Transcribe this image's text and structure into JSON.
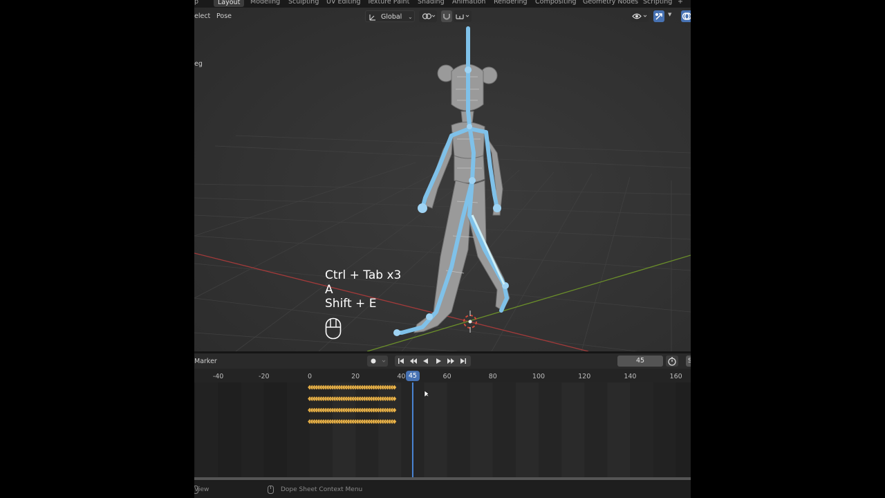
{
  "workspace_tabs": [
    {
      "label": "p",
      "active": false
    },
    {
      "label": "Layout",
      "active": true
    },
    {
      "label": "Modeling",
      "active": false
    },
    {
      "label": "Sculpting",
      "active": false
    },
    {
      "label": "UV Editing",
      "active": false
    },
    {
      "label": "Texture Paint",
      "active": false
    },
    {
      "label": "Shading",
      "active": false
    },
    {
      "label": "Animation",
      "active": false
    },
    {
      "label": "Rendering",
      "active": false
    },
    {
      "label": "Compositing",
      "active": false
    },
    {
      "label": "Geometry Nodes",
      "active": false
    },
    {
      "label": "Scripting",
      "active": false
    },
    {
      "label": "+",
      "active": false
    }
  ],
  "viewport": {
    "menu": {
      "select": "elect",
      "pose": "Pose"
    },
    "transform_orientation": "Global",
    "side_label": "eg",
    "key_overlay": [
      "Ctrl + Tab x3",
      "A",
      "Shift + E"
    ],
    "colors": {
      "bone": "#7fc1e9",
      "x_axis": "#a23a3a",
      "y_axis": "#6b8f2a",
      "accent": "#4772b3"
    }
  },
  "timeline": {
    "marker_label": "Marker",
    "current_frame": "45",
    "current_frame_indicator": "45",
    "cut_label": "S",
    "ruler_ticks": [
      "-40",
      "-20",
      "0",
      "20",
      "40",
      "60",
      "80",
      "100",
      "120",
      "140",
      "160"
    ],
    "keyframe_rows": 4,
    "keyframe_range": [
      0,
      37
    ],
    "keyframe_color": "#e9b34a"
  },
  "statusbar": {
    "left": "View",
    "middle": "Dope Sheet Context Menu"
  }
}
